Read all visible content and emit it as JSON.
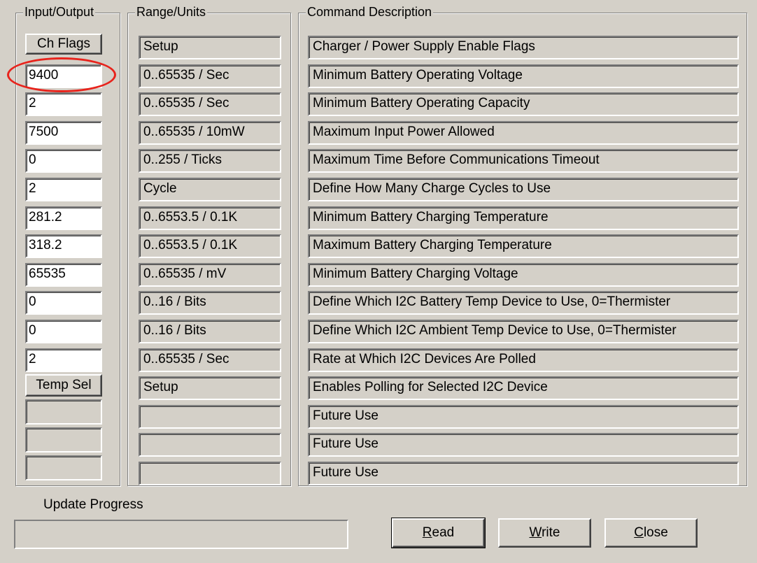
{
  "groups": {
    "io": "Input/Output",
    "range": "Range/Units",
    "desc": "Command Description"
  },
  "buttons": {
    "ch_flags": "Ch Flags",
    "temp_sel": "Temp Sel",
    "read": "Read",
    "write": "Write",
    "close": "Close"
  },
  "io_values": [
    "9400",
    "2",
    "7500",
    "0",
    "2",
    "281.2",
    "318.2",
    "65535",
    "0",
    "0",
    "2"
  ],
  "range_units": [
    "Setup",
    "0..65535 / Sec",
    "0..65535 / Sec",
    "0..65535 / 10mW",
    "0..255 / Ticks",
    "Cycle",
    "0..6553.5 / 0.1K",
    "0..6553.5 / 0.1K",
    "0..65535 / mV",
    "0..16 / Bits",
    "0..16 / Bits",
    "0..65535 / Sec",
    "Setup",
    "",
    "",
    ""
  ],
  "descriptions": [
    "Charger / Power Supply Enable Flags",
    "Minimum Battery Operating Voltage",
    "Minimum Battery Operating Capacity",
    "Maximum Input Power Allowed",
    "Maximum Time Before Communications Timeout",
    "Define How Many Charge Cycles to Use",
    "Minimum Battery Charging Temperature",
    "Maximum Battery Charging Temperature",
    "Minimum Battery Charging Voltage",
    "Define Which I2C Battery Temp Device to Use, 0=Thermister",
    "Define Which I2C Ambient Temp Device to Use, 0=Thermister",
    "Rate at Which I2C Devices Are Polled",
    "Enables Polling for Selected I2C Device",
    "Future Use",
    "Future Use",
    "Future Use"
  ],
  "progress": {
    "label": "Update Progress",
    "value": 0
  },
  "colors": {
    "background": "#d4d0c8",
    "highlight_ring": "#e8231c",
    "progress_fill": "#000080"
  }
}
